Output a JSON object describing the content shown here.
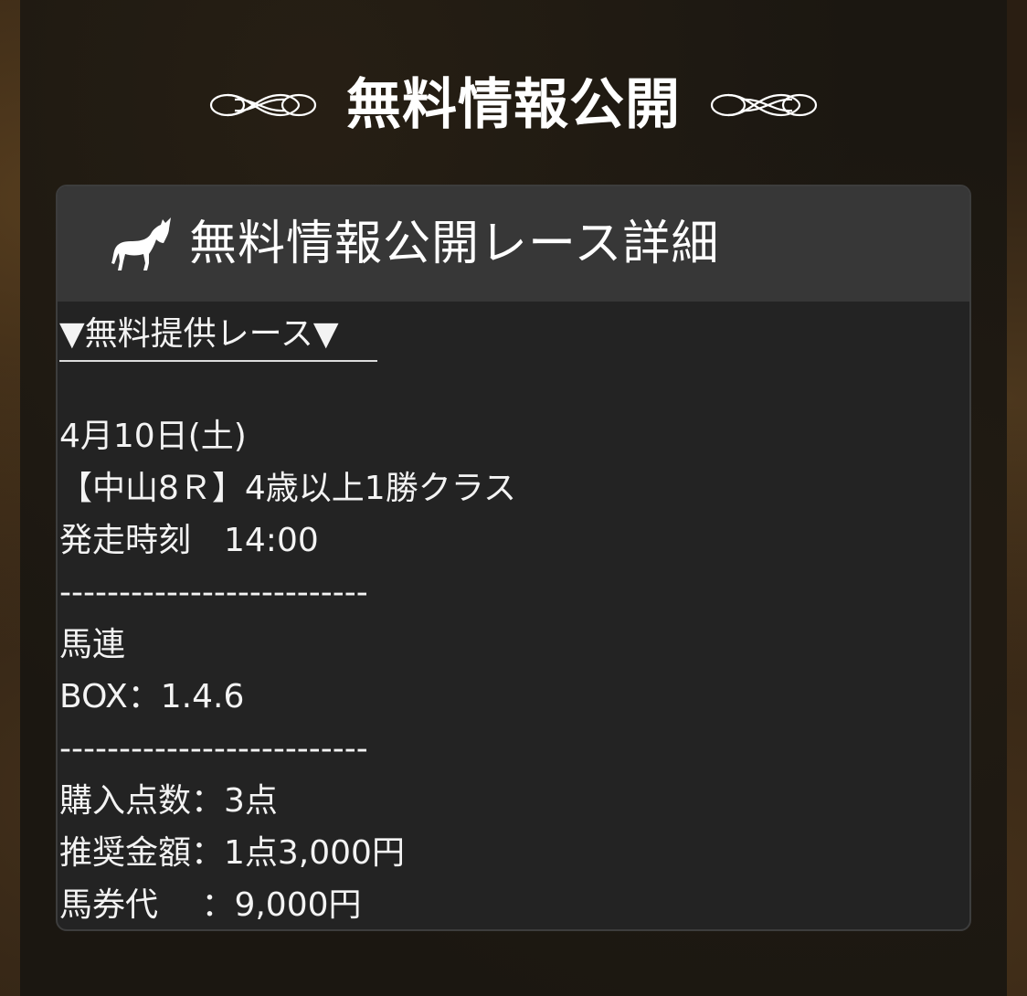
{
  "heading": {
    "text": "無料情報公開"
  },
  "card": {
    "title": "無料情報公開レース詳細",
    "icon": "horse-icon",
    "offer_title": "▼無料提供レース▼",
    "date": "4月10日(土)",
    "race": "【中山8Ｒ】4歳以上1勝クラス",
    "start_time": "発走時刻　14:00",
    "separator": "--------------------------",
    "bet_type": "馬連",
    "box": "BOX：1.4.6",
    "points": "購入点数：3点",
    "recommended": "推奨金額：1点3,000円",
    "ticket_cost": "馬券代　 ：9,000円"
  },
  "colors": {
    "page_bg": "#1b1711",
    "card_bg": "#232323",
    "card_header_bg": "#373737",
    "text": "#ffffff"
  }
}
